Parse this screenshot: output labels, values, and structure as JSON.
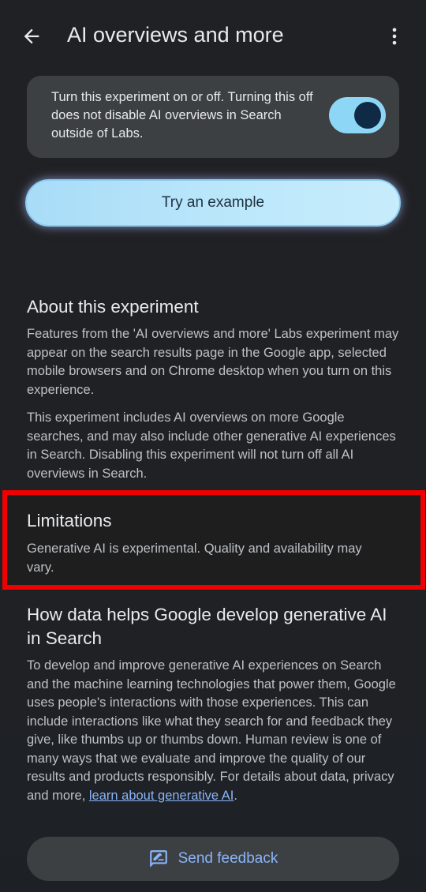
{
  "header": {
    "title": "AI overviews and more",
    "back_icon": "arrow-back-icon",
    "more_icon": "more-vert-icon"
  },
  "toggle_card": {
    "text": "Turn this experiment on or off. Turning this off does not disable AI overviews in Search outside of Labs.",
    "switch_on": true
  },
  "try_button": {
    "label": "Try an example"
  },
  "about": {
    "heading": "About this experiment",
    "paragraph_1": "Features from the 'AI overviews and more' Labs experiment may appear on the search results page in the Google app, selected mobile browsers and on Chrome desktop when you turn on this experience.",
    "paragraph_2": "This experiment includes AI overviews on more Google searches, and may also include other generative AI experiences in Search. Disabling this experiment will not turn off all AI overviews in Search."
  },
  "limitations": {
    "heading": "Limitations",
    "body": "Generative AI is experimental. Quality and availability may vary."
  },
  "data_section": {
    "heading": "How data helps Google develop generative AI in Search",
    "body": "To develop and improve generative AI experiences on Search and the machine learning technologies that power them, Google uses people's interactions with those experiences. This can include interactions like what they search for and feedback they give, like thumbs up or thumbs down. Human review is one of many ways that we evaluate and improve the quality of our results and products responsibly. For details about data, privacy and more, ",
    "link_text": "learn about generative AI",
    "trailing": "."
  },
  "feedback_button": {
    "label": "Send feedback",
    "icon": "feedback-icon"
  },
  "colors": {
    "background": "#202124",
    "card": "#3c4043",
    "accent_link": "#8ab4f8",
    "switch_track": "#8ed6f5",
    "highlight_border": "#f00000"
  }
}
